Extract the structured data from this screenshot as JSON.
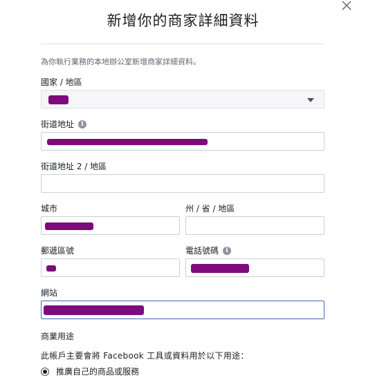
{
  "dialog": {
    "title": "新增你的商家詳細資料",
    "intro": "為你執行業務的本地辦公室新增商家詳細資料。",
    "close_icon": "close-icon"
  },
  "fields": {
    "country": {
      "label": "國家 / 地區",
      "value": ""
    },
    "street": {
      "label": "街道地址",
      "value": ""
    },
    "street2": {
      "label": "街道地址 2 / 地區",
      "value": ""
    },
    "city": {
      "label": "城市",
      "value": ""
    },
    "state": {
      "label": "州 / 省 / 地區",
      "value": ""
    },
    "postal": {
      "label": "郵遞區號",
      "value": ""
    },
    "phone": {
      "label": "電話號碼",
      "value": ""
    },
    "website": {
      "label": "網站",
      "value": ""
    }
  },
  "usage": {
    "section_label": "商業用途",
    "description": "此帳戶主要會將 Facebook 工具或資料用於以下用途：",
    "option_1": "推廣自己的商品或服務"
  },
  "colors": {
    "redaction": "#7d0b7d",
    "focus": "#4267b2"
  }
}
